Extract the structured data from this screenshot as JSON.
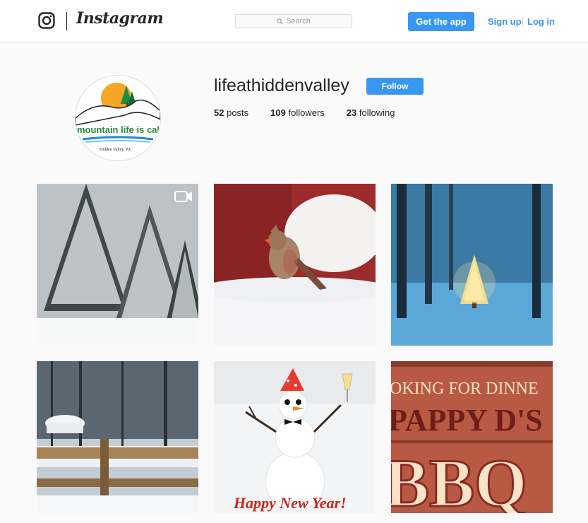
{
  "header": {
    "wordmark": "Instagram",
    "search_placeholder": "Search",
    "get_app_label": "Get the app",
    "signup_label": "Sign up",
    "separator": "|",
    "login_label": "Log in"
  },
  "profile": {
    "username": "lifeathiddenvalley",
    "follow_label": "Follow",
    "avatar_text": "mountain life is calli",
    "avatar_subtext": "Hidden Valley, PA",
    "posts_count": "52",
    "posts_label": "posts",
    "followers_count": "109",
    "followers_label": "followers",
    "following_count": "23",
    "following_label": "following"
  },
  "posts": [
    {
      "name": "post-snowy-pines",
      "is_video": true
    },
    {
      "name": "post-cardinal"
    },
    {
      "name": "post-lit-tree"
    },
    {
      "name": "post-snowy-fence"
    },
    {
      "name": "post-snowman",
      "caption": "Happy New Year!"
    },
    {
      "name": "post-bbq",
      "line1": "OKING FOR DINNE",
      "line2": "PAPPY D'S",
      "line3": "BBQ"
    }
  ],
  "colors": {
    "accent": "#3897f0",
    "text": "#262626",
    "background": "#fafafa",
    "border": "#dbdbdb"
  }
}
